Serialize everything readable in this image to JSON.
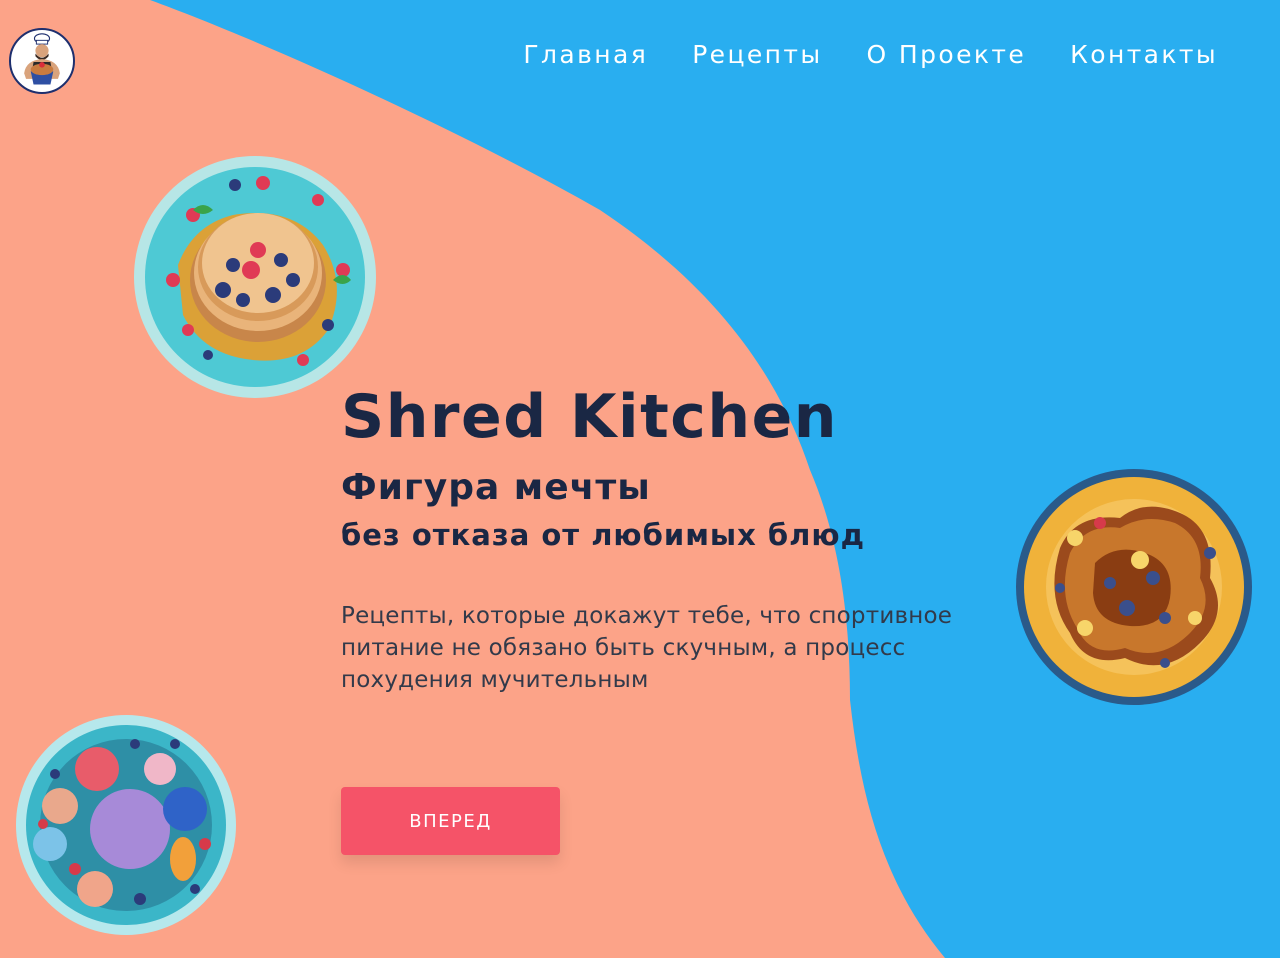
{
  "header": {
    "logo_icon": "chef-cupcake-logo-icon",
    "nav": [
      {
        "label": "Главная"
      },
      {
        "label": "Рецепты"
      },
      {
        "label": "О Проекте"
      },
      {
        "label": "Контакты"
      }
    ]
  },
  "hero": {
    "title": "Shred Kitchen",
    "subtitle": "Фигура мечты",
    "subtitle2": "без отказа от любимых блюд",
    "description": "Рецепты, которые докажут тебе, что спортивное питание не обязано быть скучным, а процесс похудения мучительным",
    "cta_label": "ВПЕРЕД"
  },
  "images": {
    "pancakes": "pancakes-plate-image",
    "french_toast": "french-toast-plate-image",
    "ice_cream": "ice-cream-plate-image"
  },
  "colors": {
    "blue_background": "#29aef0",
    "peach_shape": "#fca388",
    "text_dark": "#1a2744",
    "cta": "#f55368",
    "nav_text": "#ffffff"
  }
}
